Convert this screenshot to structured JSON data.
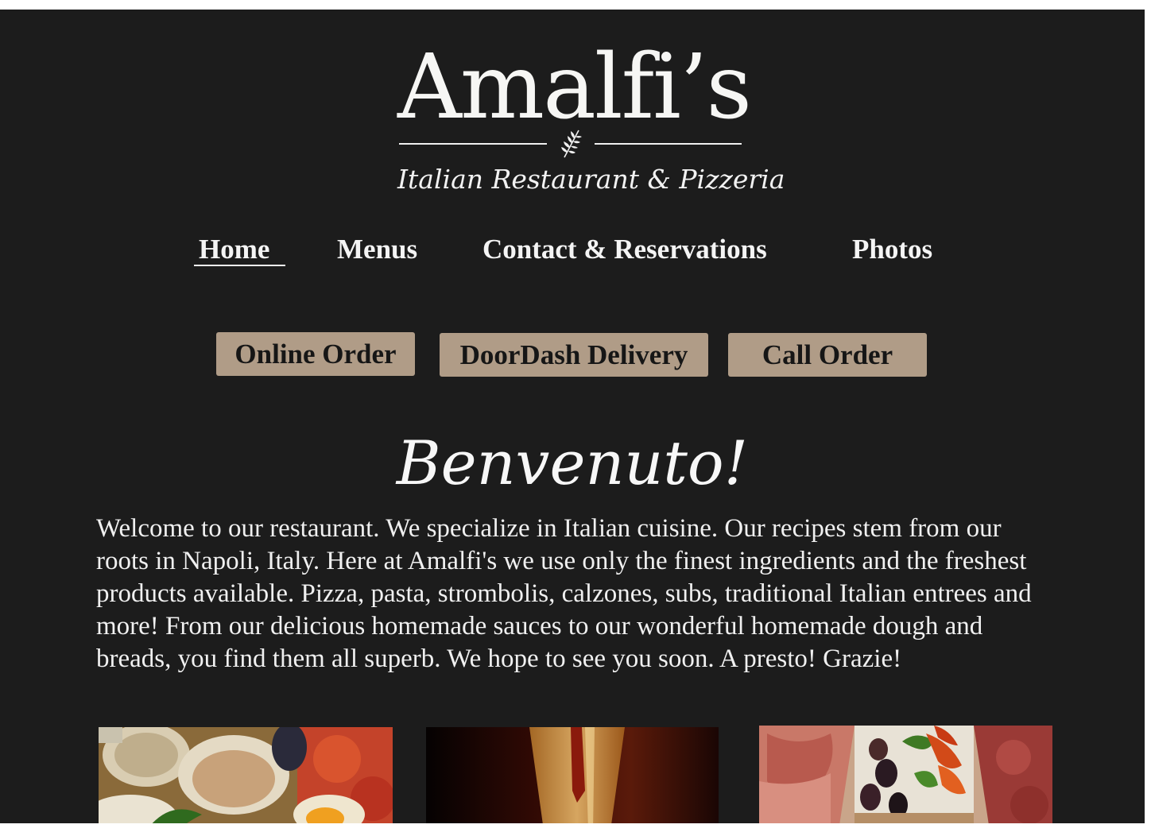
{
  "logo": {
    "title": "Amalfi’s",
    "subtitle": "Italian Restaurant & Pizzeria",
    "ornament_icon": "rosemary-sprig-icon"
  },
  "nav": {
    "items": [
      {
        "label": "Home",
        "active": true
      },
      {
        "label": "Menus",
        "active": false
      },
      {
        "label": "Contact & Reservations",
        "active": false
      },
      {
        "label": "Photos",
        "active": false
      }
    ]
  },
  "order_buttons": [
    {
      "label": "Online Order"
    },
    {
      "label": "DoorDash Delivery"
    },
    {
      "label": "Call Order"
    }
  ],
  "welcome": {
    "heading": "Benvenuto!",
    "body": "Welcome to our restaurant. We specialize in Italian cuisine. Our recipes stem from our roots in Napoli, Italy.  Here at Amalfi's we use only the finest ingredients and the freshest products available.  Pizza, pasta, strombolis, calzones, subs, traditional Italian entrees and more! From our delicious homemade sauces to our wonderful homemade dough and breads, you find them all superb.  We hope to see you soon.  A presto!  Grazie!"
  },
  "photos": [
    {
      "subject": "seafood-clams-mussels-photo"
    },
    {
      "subject": "wine-glass-photo"
    },
    {
      "subject": "antipasto-platter-photo"
    }
  ],
  "colors": {
    "background": "#1c1c1c",
    "button": "#b09c87",
    "text": "#f2f2f2"
  }
}
